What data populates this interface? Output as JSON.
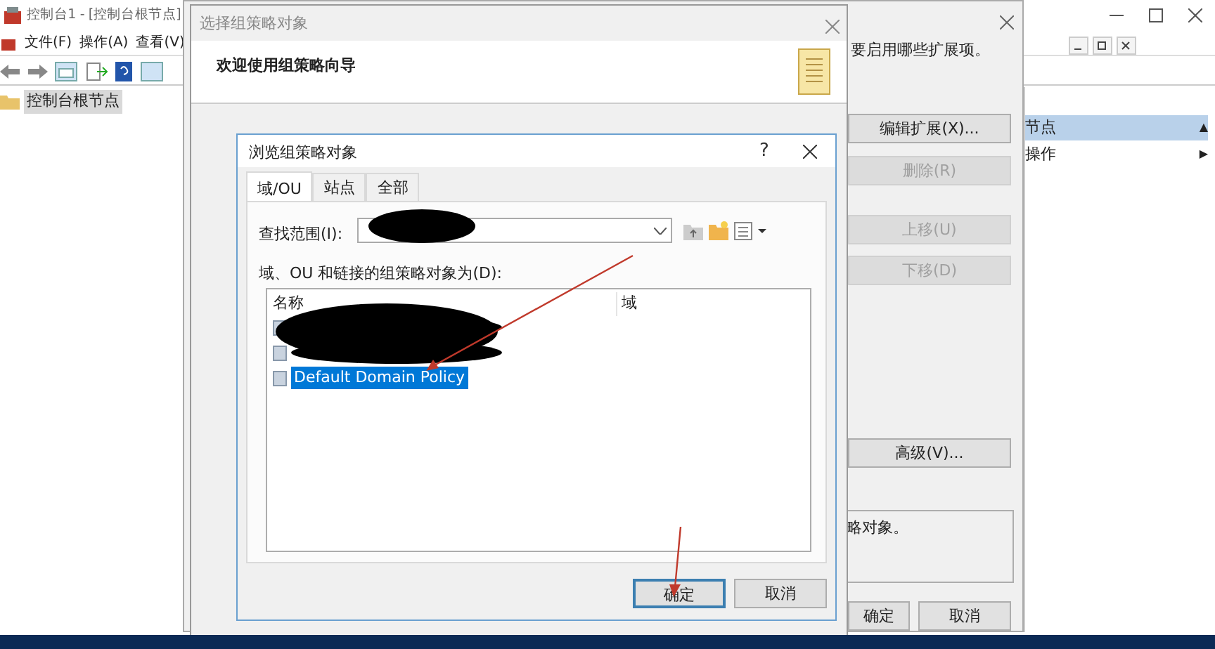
{
  "main_window": {
    "title": "控制台1 - [控制台根节点]",
    "menu": [
      "文件(F)",
      "操作(A)",
      "查看(V)"
    ],
    "tree": [
      {
        "label": "控制台根节点",
        "selected": true
      }
    ],
    "actions": [
      {
        "kind": "header",
        "label": "节点",
        "arrow": "▲"
      },
      {
        "kind": "item",
        "label": "操作",
        "arrow": "▶"
      }
    ]
  },
  "back_dialog": {
    "prompt": "要启用哪些扩展项。",
    "buttons": [
      {
        "label": "编辑扩展(X)...",
        "disabled": false
      },
      {
        "label": "删除(R)",
        "disabled": true
      },
      {
        "label": "上移(U)",
        "disabled": true
      },
      {
        "label": "下移(D)",
        "disabled": true
      },
      {
        "label": "高级(V)...",
        "disabled": false
      }
    ],
    "description": "略对象。",
    "footer_buttons": [
      "确定",
      "取消"
    ]
  },
  "wizard": {
    "title": "选择组策略对象",
    "heading": "欢迎使用组策略向导"
  },
  "browse_dialog": {
    "title": "浏览组策略对象",
    "help": "?",
    "tabs": [
      {
        "label": "域/OU",
        "selected": true
      },
      {
        "label": "站点",
        "selected": false
      },
      {
        "label": "全部",
        "selected": false
      }
    ],
    "look_in_label": "查找范围(I):",
    "list_label": "域、OU 和链接的组策略对象为(D):",
    "columns": [
      "名称",
      "域"
    ],
    "rows": [
      {
        "kind": "redacted"
      },
      {
        "kind": "redacted"
      },
      {
        "kind": "item",
        "name": "Default Domain Policy",
        "selected": true
      }
    ],
    "buttons": [
      {
        "label": "确定",
        "default": true
      },
      {
        "label": "取消",
        "default": false
      }
    ]
  }
}
